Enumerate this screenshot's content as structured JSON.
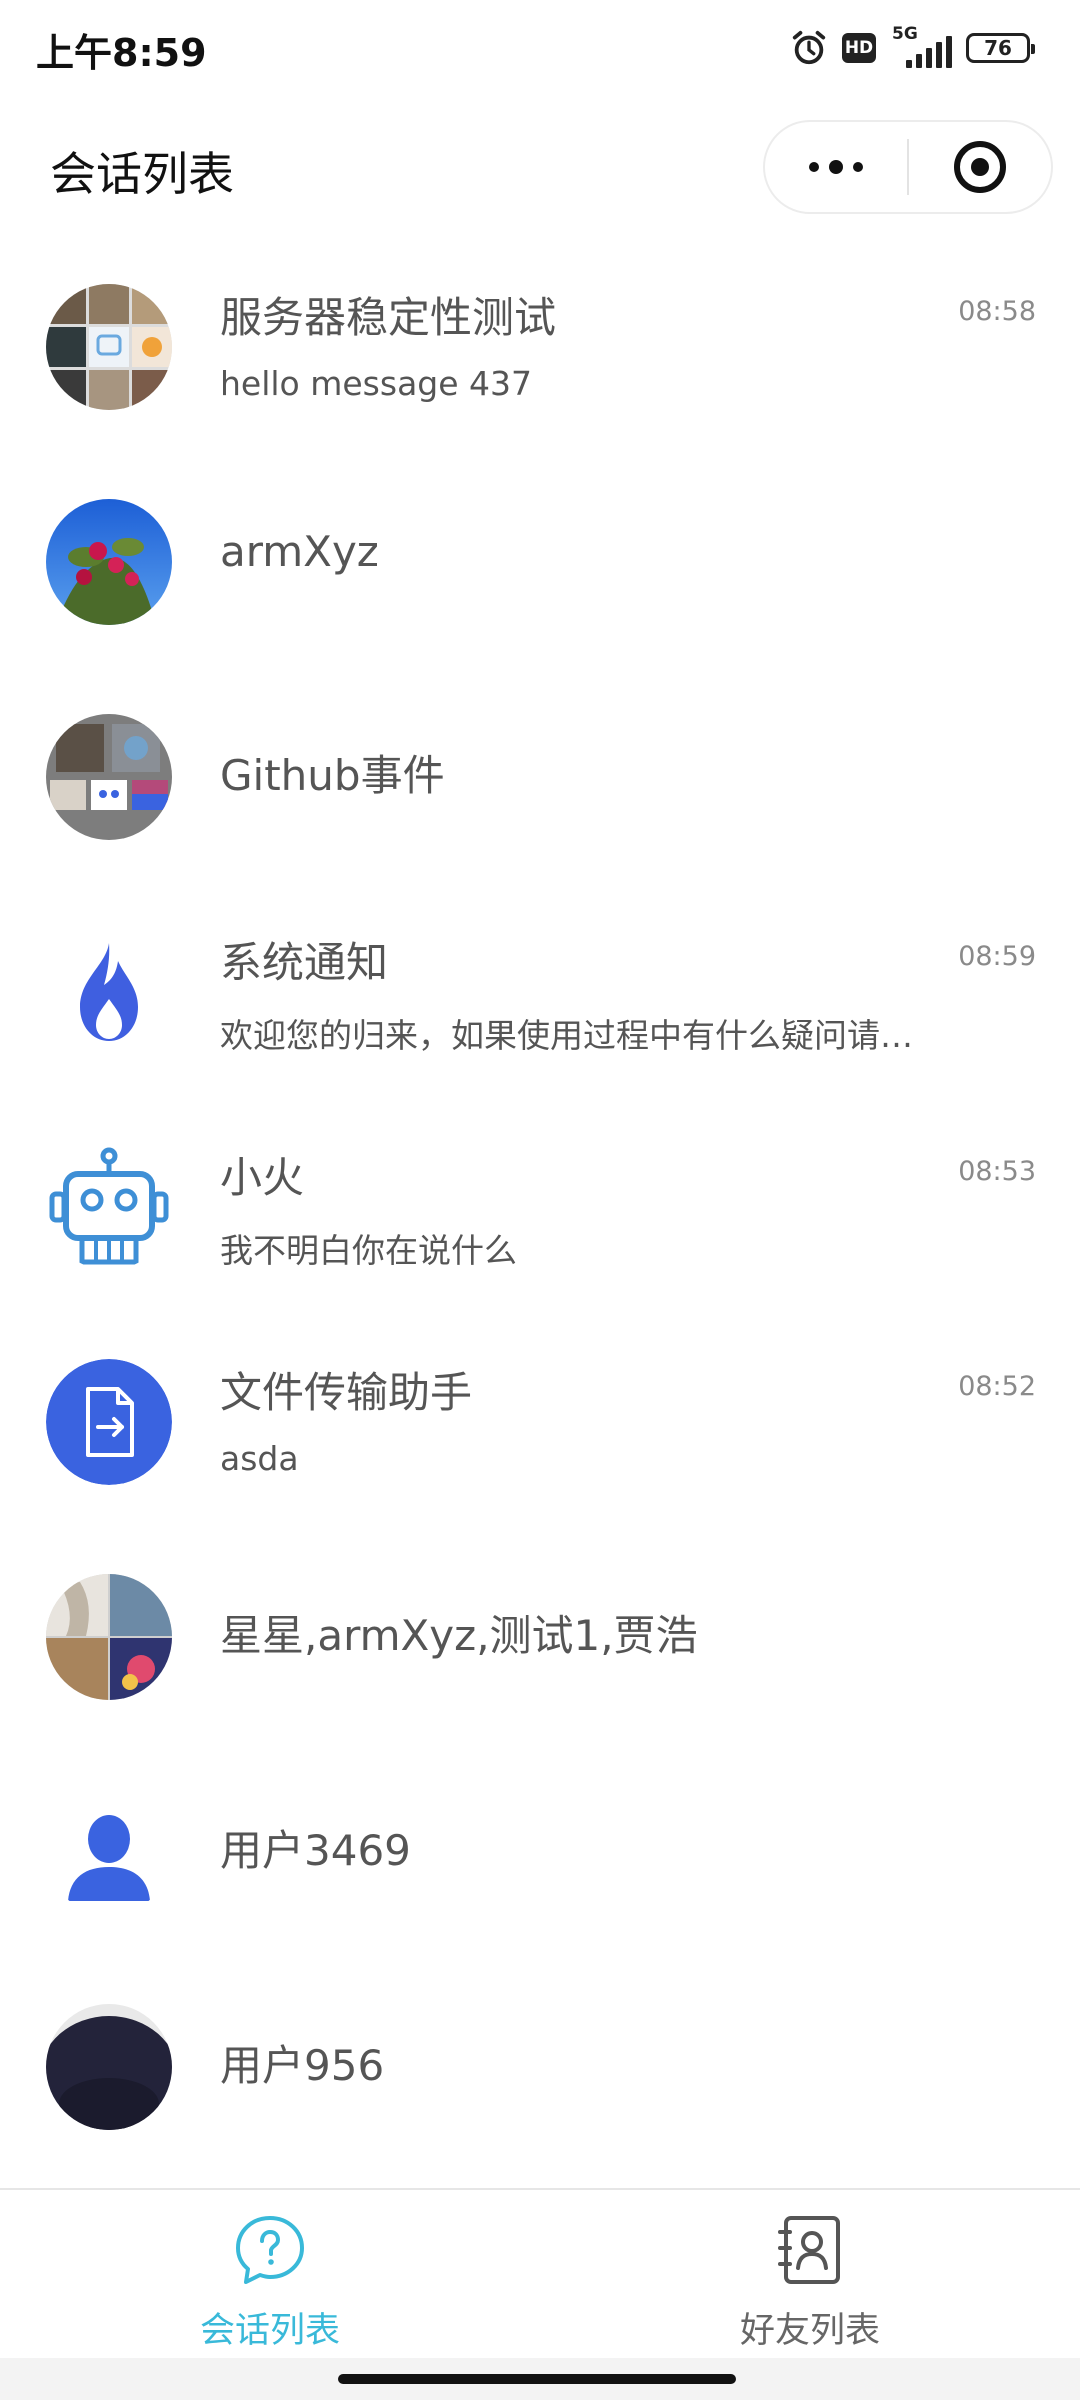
{
  "status_bar": {
    "time": "上午8:59",
    "hd_label": "HD",
    "network_label": "5G",
    "battery_level": "76",
    "icons": [
      "alarm-icon",
      "hd-icon",
      "signal-icon",
      "battery-icon"
    ]
  },
  "header": {
    "title": "会话列表",
    "capsule_icons": [
      "more-dots-icon",
      "target-close-icon"
    ]
  },
  "conversations": [
    {
      "name": "服务器稳定性测试",
      "preview": "hello message 437",
      "time": "08:58",
      "avatar": "group-collage-avatar"
    },
    {
      "name": "armXyz",
      "preview": "",
      "time": "",
      "avatar": "flower-photo-avatar"
    },
    {
      "name": "Github事件",
      "preview": "",
      "time": "",
      "avatar": "group-collage-avatar"
    },
    {
      "name": "系统通知",
      "preview": "欢迎您的归来，如果使用过程中有什么疑问请…",
      "time": "08:59",
      "avatar": "flame-icon"
    },
    {
      "name": "小火",
      "preview": "我不明白你在说什么",
      "time": "08:53",
      "avatar": "robot-icon"
    },
    {
      "name": "文件传输助手",
      "preview": "asda",
      "time": "08:52",
      "avatar": "file-transfer-icon"
    },
    {
      "name": "星星,armXyz,测试1,贾浩",
      "preview": "",
      "time": "",
      "avatar": "group-collage-avatar"
    },
    {
      "name": "用户3469",
      "preview": "",
      "time": "",
      "avatar": "person-icon"
    },
    {
      "name": "用户956",
      "preview": "",
      "time": "",
      "avatar": "dark-photo-avatar"
    }
  ],
  "tabs": [
    {
      "label": "会话列表",
      "icon": "chat-question-icon",
      "active": true
    },
    {
      "label": "好友列表",
      "icon": "contacts-book-icon",
      "active": false
    }
  ],
  "colors": {
    "accent_active_tab": "#39b9d9",
    "flame_blue": "#3f5fe0",
    "file_transfer_bg": "#3a63e0",
    "robot_blue": "#3e8fd6",
    "person_blue": "#3a63e0"
  }
}
